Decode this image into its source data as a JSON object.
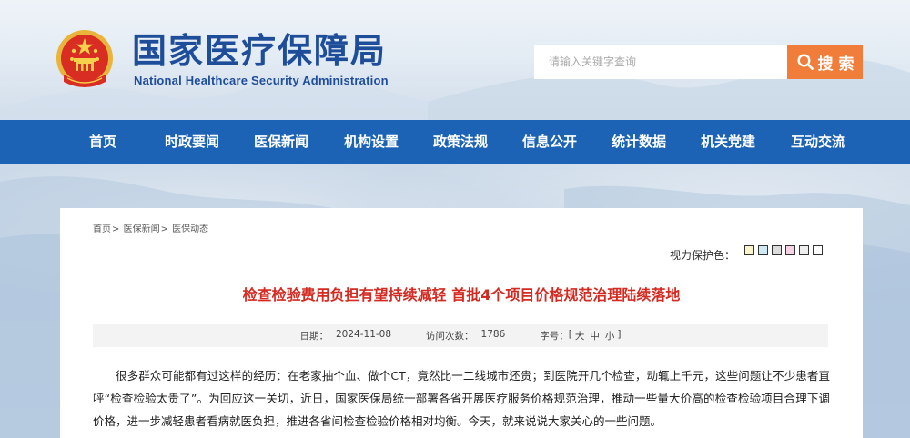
{
  "header": {
    "site_title": "国家医疗保障局",
    "site_subtitle": "National Healthcare Security Administration",
    "search_placeholder": "请输入关键字查询",
    "search_button": "搜 索"
  },
  "nav": {
    "items": [
      {
        "label": "首页"
      },
      {
        "label": "时政要闻"
      },
      {
        "label": "医保新闻"
      },
      {
        "label": "机构设置"
      },
      {
        "label": "政策法规"
      },
      {
        "label": "信息公开"
      },
      {
        "label": "统计数据"
      },
      {
        "label": "机关党建"
      },
      {
        "label": "互动交流"
      }
    ]
  },
  "breadcrumb": {
    "items": [
      "首页",
      "医保新闻",
      "医保动态"
    ],
    "separator": ">"
  },
  "eye_protection": {
    "label": "视力保护色：",
    "swatches": [
      "#f8f4cc",
      "#cfe8f5",
      "#dcdcdc",
      "#f5d2e6",
      "#eeeeee",
      "#ffffff"
    ]
  },
  "article": {
    "title": "检查检验费用负担有望持续减轻 首批4个项目价格规范治理陆续落地",
    "meta": {
      "date_label": "日期：",
      "date": "2024-11-08",
      "visits_label": "访问次数：",
      "visits": "1786",
      "fontsize_label": "字号：",
      "fontsize_open": "[",
      "fontsize_large": "大",
      "fontsize_medium": "中",
      "fontsize_small": "小",
      "fontsize_close": "]"
    },
    "body": "很多群众可能都有过这样的经历：在老家抽个血、做个CT，竟然比一二线城市还贵；到医院开几个检查，动辄上千元，这些问题让不少患者直呼“检查检验太贵了”。为回应这一关切，近日，国家医保局统一部署各省开展医疗服务价格规范治理，推动一些量大价高的检查检验项目合理下调价格，进一步减轻患者看病就医负担，推进各省间检查检验价格相对均衡。今天，就来说说大家关心的一些问题。"
  },
  "colors": {
    "brand_blue": "#1e4d9a",
    "nav_blue": "#1c63b6",
    "search_orange": "#f07e3a",
    "title_red": "#d42a21"
  }
}
